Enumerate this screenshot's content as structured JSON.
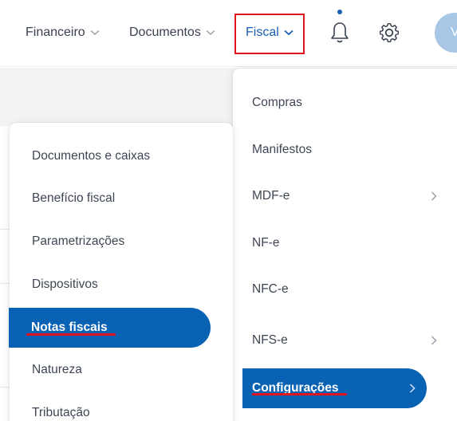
{
  "topbar": {
    "nav": [
      {
        "label": "Financeiro"
      },
      {
        "label": "Documentos"
      },
      {
        "label": "Fiscal"
      }
    ],
    "avatar_initial": "V"
  },
  "fiscal_menu": {
    "items": [
      {
        "label": "Compras",
        "has_submenu": false
      },
      {
        "label": "Manifestos",
        "has_submenu": false
      },
      {
        "label": "MDF-e",
        "has_submenu": true
      },
      {
        "label": "NF-e",
        "has_submenu": false
      },
      {
        "label": "NFC-e",
        "has_submenu": false
      },
      {
        "label": "NFS-e",
        "has_submenu": true
      },
      {
        "label": "Configurações",
        "has_submenu": true,
        "active": true
      }
    ]
  },
  "config_menu": {
    "items": [
      {
        "label": "Documentos e caixas"
      },
      {
        "label": "Benefício fiscal"
      },
      {
        "label": "Parametrizações"
      },
      {
        "label": "Dispositivos"
      },
      {
        "label": "Notas fiscais",
        "active": true
      },
      {
        "label": "Natureza"
      },
      {
        "label": "Tributação"
      }
    ]
  },
  "colors": {
    "accent": "#0a62b4",
    "highlight_red": "#e0141c",
    "notification_dot": "#1a5fb4"
  },
  "icons": [
    "chevron-down-icon",
    "bell-icon",
    "gear-icon",
    "chevron-right-icon"
  ]
}
